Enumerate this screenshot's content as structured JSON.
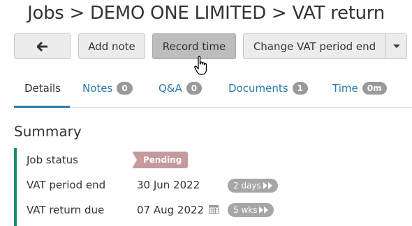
{
  "page": {
    "title": "Jobs > DEMO ONE LIMITED > VAT return"
  },
  "toolbar": {
    "back_icon": "arrow-left-icon",
    "add_note": "Add note",
    "record_time": "Record time",
    "change_vat_period_end": "Change VAT period end",
    "dropdown_icon": "caret-down-icon"
  },
  "tabs": [
    {
      "label": "Details",
      "selected": true
    },
    {
      "label": "Notes",
      "count": "0"
    },
    {
      "label": "Q&A",
      "count": "0"
    },
    {
      "label": "Documents",
      "count": "1"
    },
    {
      "label": "Time",
      "count": "0m"
    }
  ],
  "summary": {
    "title": "Summary",
    "job_status_label": "Job status",
    "job_status_value": "Pending",
    "vat_period_end_label": "VAT period end",
    "vat_period_end_value": "30 Jun 2022",
    "vat_period_end_badge": "2 days",
    "vat_return_due_label": "VAT return due",
    "vat_return_due_value": "07 Aug 2022",
    "vat_return_due_badge": "5 wks"
  },
  "colors": {
    "accent": "#2a7ab0",
    "summary_bar": "#1a8a6e",
    "pending_badge": "#c49a9c",
    "pill": "#999999"
  }
}
